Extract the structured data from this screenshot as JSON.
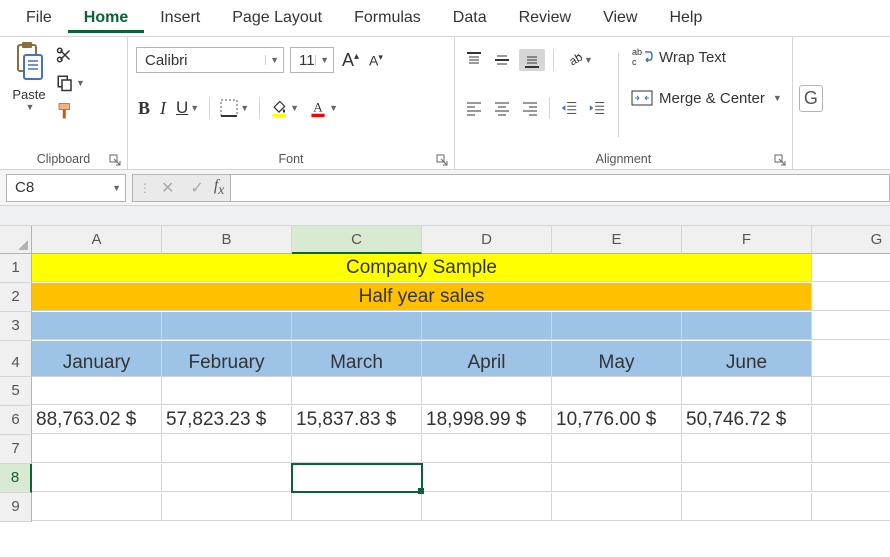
{
  "menu": {
    "items": [
      "File",
      "Home",
      "Insert",
      "Page Layout",
      "Formulas",
      "Data",
      "Review",
      "View",
      "Help"
    ],
    "active": "Home"
  },
  "ribbon": {
    "clipboard": {
      "label": "Clipboard",
      "paste": "Paste"
    },
    "font": {
      "label": "Font",
      "name": "Calibri",
      "size": "11"
    },
    "alignment": {
      "label": "Alignment",
      "wrap": "Wrap Text",
      "merge": "Merge & Center"
    }
  },
  "nameBox": "C8",
  "formula": "",
  "columns": [
    "A",
    "B",
    "C",
    "D",
    "E",
    "F",
    "G"
  ],
  "rows": [
    "1",
    "2",
    "3",
    "4",
    "5",
    "6",
    "7",
    "8",
    "9"
  ],
  "sheet": {
    "title": "Company Sample",
    "subtitle": "Half year sales",
    "months": [
      "January",
      "February",
      "March",
      "April",
      "May",
      "June"
    ],
    "values": [
      "88,763.02 $",
      "57,823.23 $",
      "15,837.83 $",
      "18,998.99 $",
      "10,776.00 $",
      "50,746.72 $"
    ]
  },
  "activeCell": {
    "col": "C",
    "row": "8"
  },
  "partialBtn": "G",
  "chart_data": {
    "type": "table",
    "title": "Company Sample",
    "subtitle": "Half year sales",
    "categories": [
      "January",
      "February",
      "March",
      "April",
      "May",
      "June"
    ],
    "values": [
      88763.02,
      57823.23,
      15837.83,
      18998.99,
      10776.0,
      50746.72
    ],
    "unit": "$"
  }
}
